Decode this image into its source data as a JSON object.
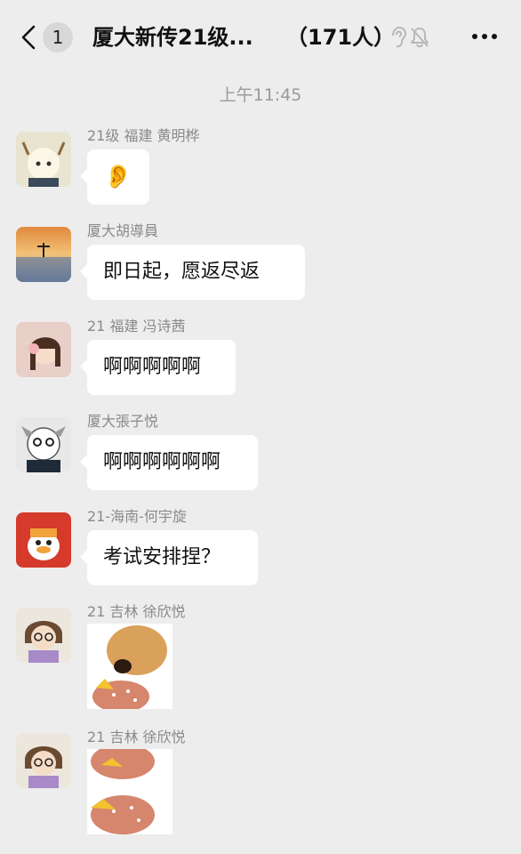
{
  "header": {
    "unread_count": "1",
    "title": "厦大新传21级...",
    "member_count": "（171人）",
    "icons": [
      "back-icon",
      "ear-icon",
      "mute-bell-icon",
      "more-icon"
    ]
  },
  "timestamp": "上午11:45",
  "messages": [
    {
      "sender": "21级 福建 黄明桦",
      "content_emoji": "👂"
    },
    {
      "sender": "厦大胡導員",
      "text": "即日起，愿返尽返"
    },
    {
      "sender": "21 福建 冯诗茜",
      "text": "啊啊啊啊啊"
    },
    {
      "sender": "厦大張子悦",
      "text": "啊啊啊啊啊啊"
    },
    {
      "sender": "21-海南-何宇旋",
      "text": "考试安排捏？"
    },
    {
      "sender": "21 吉林 徐欣悦",
      "sticker": "dog-eating-burger-sticker"
    },
    {
      "sender": "21 吉林 徐欣悦",
      "sticker": "burger-sticker"
    }
  ],
  "colors": {
    "background": "#ededed",
    "bubble": "#ffffff",
    "sender_text": "#8a8a8a",
    "timestamp_text": "#9a9a9a"
  }
}
